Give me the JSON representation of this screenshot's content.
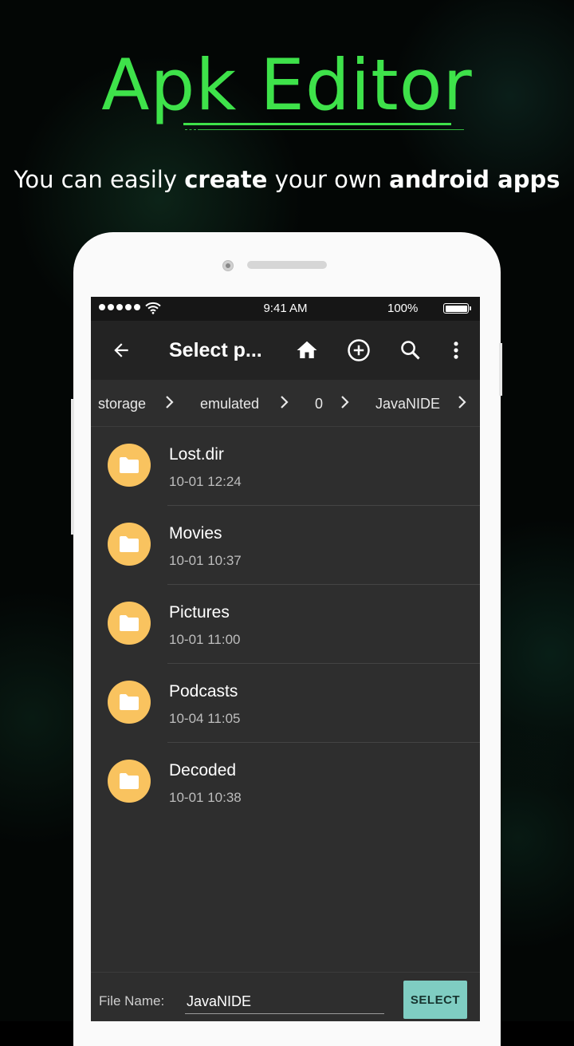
{
  "promo": {
    "headline": "Apk Editor",
    "tagline_parts": [
      "You can easily ",
      "create",
      " your own ",
      "android apps"
    ],
    "accent_color": "#3ee24a"
  },
  "statusbar": {
    "time": "9:41 AM",
    "battery": "100%"
  },
  "toolbar": {
    "title": "Select p...",
    "icons": [
      "back-arrow-icon",
      "home-icon",
      "add-circle-icon",
      "search-icon",
      "more-vert-icon"
    ]
  },
  "breadcrumb": [
    "storage",
    "emulated",
    "0",
    "JavaNIDE"
  ],
  "files": [
    {
      "name": "Lost.dir",
      "date": "10-01 12:24"
    },
    {
      "name": "Movies",
      "date": "10-01 10:37"
    },
    {
      "name": "Pictures",
      "date": "10-01 11:00"
    },
    {
      "name": "Podcasts",
      "date": "10-04 11:05"
    },
    {
      "name": "Decoded",
      "date": "10-01 10:38"
    }
  ],
  "footer": {
    "file_name_label": "File Name:",
    "file_name_value": "JavaNIDE",
    "select_label": "SELECT"
  },
  "colors": {
    "folder": "#f9c35f",
    "select_button": "#7fcdc2",
    "screen_bg": "#2e2e2e",
    "toolbar_bg": "#232323"
  }
}
